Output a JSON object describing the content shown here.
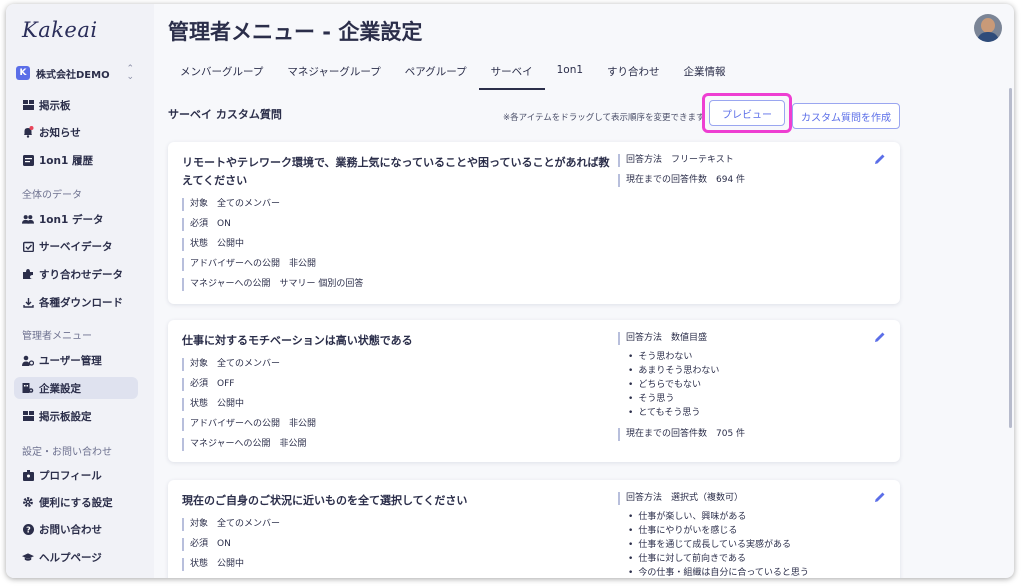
{
  "sidebar": {
    "logo": "Kakeai",
    "company": "株式会社DEMO",
    "company_badge": "K",
    "items_top": [
      {
        "label": "掲示板",
        "icon": "board-icon"
      },
      {
        "label": "お知らせ",
        "icon": "bell-icon"
      },
      {
        "label": "1on1 履歴",
        "icon": "history-icon"
      }
    ],
    "section_data": "全体のデータ",
    "items_data": [
      {
        "label": "1on1 データ",
        "icon": "users-icon"
      },
      {
        "label": "サーベイデータ",
        "icon": "survey-icon"
      },
      {
        "label": "すり合わせデータ",
        "icon": "puzzle-icon"
      },
      {
        "label": "各種ダウンロード",
        "icon": "download-icon"
      }
    ],
    "section_admin": "管理者メニュー",
    "items_admin": [
      {
        "label": "ユーザー管理",
        "icon": "user-gear-icon"
      },
      {
        "label": "企業設定",
        "icon": "company-gear-icon"
      },
      {
        "label": "掲示板設定",
        "icon": "board-icon"
      }
    ],
    "section_settings": "設定・お問い合わせ",
    "items_settings": [
      {
        "label": "プロフィール",
        "icon": "profile-icon"
      },
      {
        "label": "便利にする設定",
        "icon": "gear-icon"
      },
      {
        "label": "お問い合わせ",
        "icon": "question-icon"
      },
      {
        "label": "ヘルプページ",
        "icon": "graduation-icon"
      }
    ]
  },
  "header": {
    "title": "管理者メニュー - 企業設定"
  },
  "tabs": [
    {
      "label": "メンバーグループ"
    },
    {
      "label": "マネジャーグループ"
    },
    {
      "label": "ペアグループ"
    },
    {
      "label": "サーベイ"
    },
    {
      "label": "1on1"
    },
    {
      "label": "すり合わせ"
    },
    {
      "label": "企業情報"
    }
  ],
  "survey": {
    "section_title": "サーベイ カスタム質問",
    "drag_note": "※各アイテムをドラッグして表示順序を変更できます",
    "preview_label": "プレビュー",
    "create_label": "カスタム質問を作成"
  },
  "cards": [
    {
      "title": "リモートやテレワーク環境で、業務上気になっていることや困っていることがあれば教えてください",
      "meta": [
        "対象　全てのメンバー",
        "必須　ON",
        "状態　公開中",
        "アドバイザーへの公開　非公開",
        "マネジャーへの公開　サマリー 個別の回答"
      ],
      "answer_method": "回答方法　フリーテキスト",
      "options": [],
      "count": "現在までの回答件数　694 件"
    },
    {
      "title": "仕事に対するモチベーションは高い状態である",
      "meta": [
        "対象　全てのメンバー",
        "必須　OFF",
        "状態　公開中",
        "アドバイザーへの公開　非公開",
        "マネジャーへの公開　非公開"
      ],
      "answer_method": "回答方法　数値目盛",
      "options": [
        "そう思わない",
        "あまりそう思わない",
        "どちらでもない",
        "そう思う",
        "とてもそう思う"
      ],
      "count": "現在までの回答件数　705 件"
    },
    {
      "title": "現在のご自身のご状況に近いものを全て選択してください",
      "meta": [
        "対象　全てのメンバー",
        "必須　ON",
        "状態　公開中"
      ],
      "answer_method": "回答方法　選択式（複数可）",
      "options": [
        "仕事が楽しい、興味がある",
        "仕事にやりがいを感じる",
        "仕事を通じて成長している実感がある",
        "仕事に対して前向きである",
        "今の仕事・組織は自分に合っていると思う"
      ],
      "count": ""
    }
  ],
  "colors": {
    "accent": "#5b6ee8",
    "highlight": "#ee3fd2",
    "text": "#2b2e4a"
  }
}
